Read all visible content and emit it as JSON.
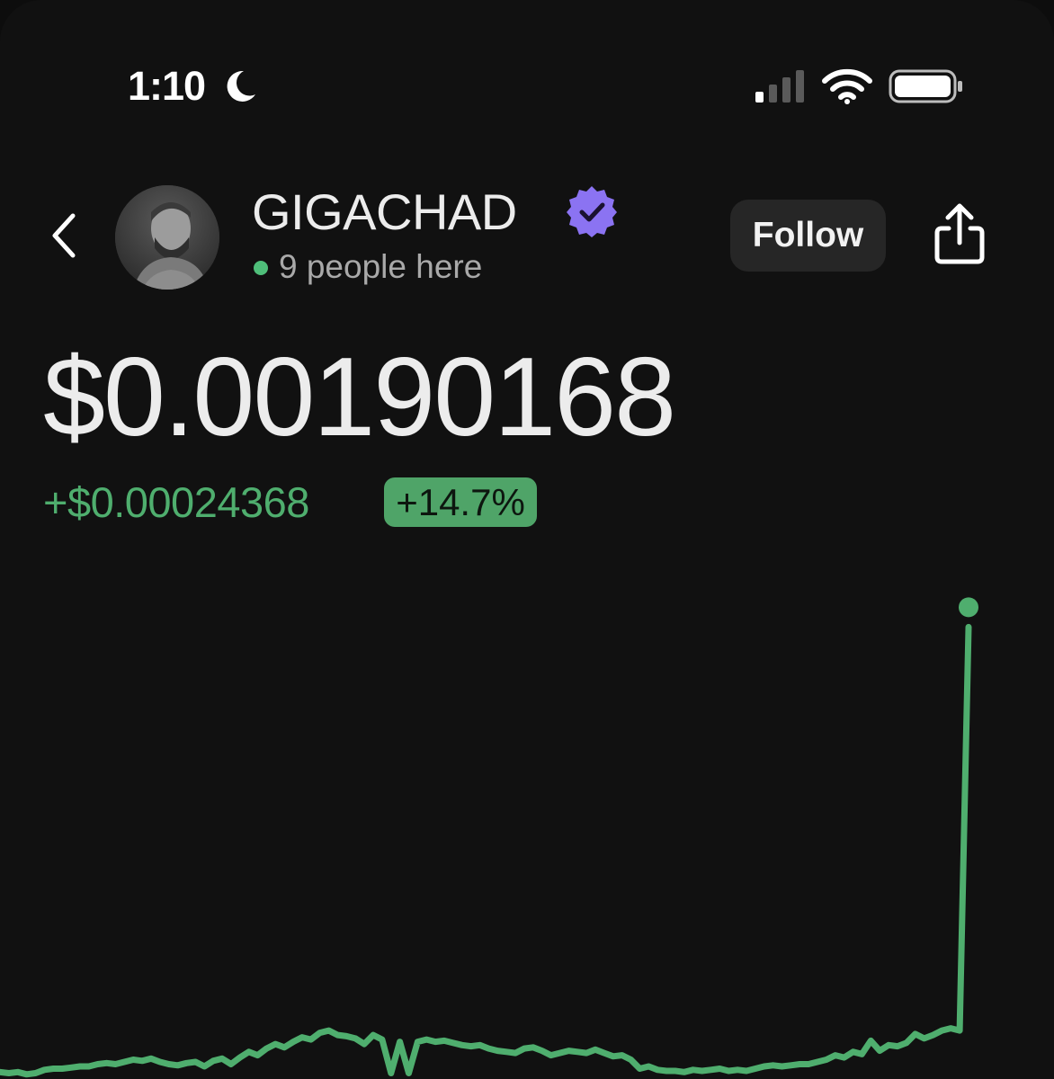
{
  "status_bar": {
    "time": "1:10",
    "moon_icon": "moon-icon",
    "signal_icon": "cellular-signal-icon",
    "wifi_icon": "wifi-icon",
    "battery_icon": "battery-icon",
    "signal_bars_active": 1,
    "signal_bars_total": 4
  },
  "header": {
    "back_icon": "chevron-left-icon",
    "coin_name": "GIGACHAD",
    "verified_icon": "verified-badge-icon",
    "presence_text": "9 people here",
    "follow_label": "Follow",
    "share_icon": "share-icon"
  },
  "price": {
    "value": "$0.00190168",
    "change_amount": "+$0.00024368",
    "change_percent": "+14.7%"
  },
  "colors": {
    "background": "#111111",
    "accent_green": "#4fae6e",
    "badge_green": "#4fa468",
    "verified_purple": "#8b73f2",
    "presence_dot": "#4fbf7a"
  },
  "chart_data": {
    "type": "line",
    "series": [
      {
        "values": [
          0.03,
          0.02,
          0.03,
          0.01,
          0.02,
          0.05,
          0.06,
          0.06,
          0.07,
          0.08,
          0.08,
          0.1,
          0.11,
          0.1,
          0.12,
          0.14,
          0.13,
          0.15,
          0.12,
          0.1,
          0.09,
          0.11,
          0.12,
          0.08,
          0.13,
          0.15,
          0.1,
          0.16,
          0.21,
          0.18,
          0.24,
          0.28,
          0.25,
          0.3,
          0.34,
          0.32,
          0.38,
          0.4,
          0.36,
          0.35,
          0.33,
          0.28,
          0.36,
          0.32,
          0.02,
          0.3,
          0.02,
          0.3,
          0.32,
          0.3,
          0.31,
          0.29,
          0.27,
          0.26,
          0.27,
          0.24,
          0.22,
          0.21,
          0.2,
          0.24,
          0.25,
          0.22,
          0.18,
          0.2,
          0.22,
          0.21,
          0.2,
          0.23,
          0.2,
          0.17,
          0.18,
          0.14,
          0.06,
          0.08,
          0.05,
          0.04,
          0.04,
          0.03,
          0.05,
          0.04,
          0.05,
          0.06,
          0.04,
          0.05,
          0.04,
          0.06,
          0.08,
          0.09,
          0.08,
          0.09,
          0.1,
          0.1,
          0.12,
          0.14,
          0.18,
          0.16,
          0.21,
          0.19,
          0.31,
          0.22,
          0.27,
          0.26,
          0.29,
          0.37,
          0.33,
          0.36,
          0.4,
          0.42,
          0.4,
          4.0
        ]
      }
    ],
    "ylim": [
      0,
      4.3
    ],
    "grid": false,
    "legend": "none",
    "line_color": "#4fae6e",
    "end_marker": true
  }
}
